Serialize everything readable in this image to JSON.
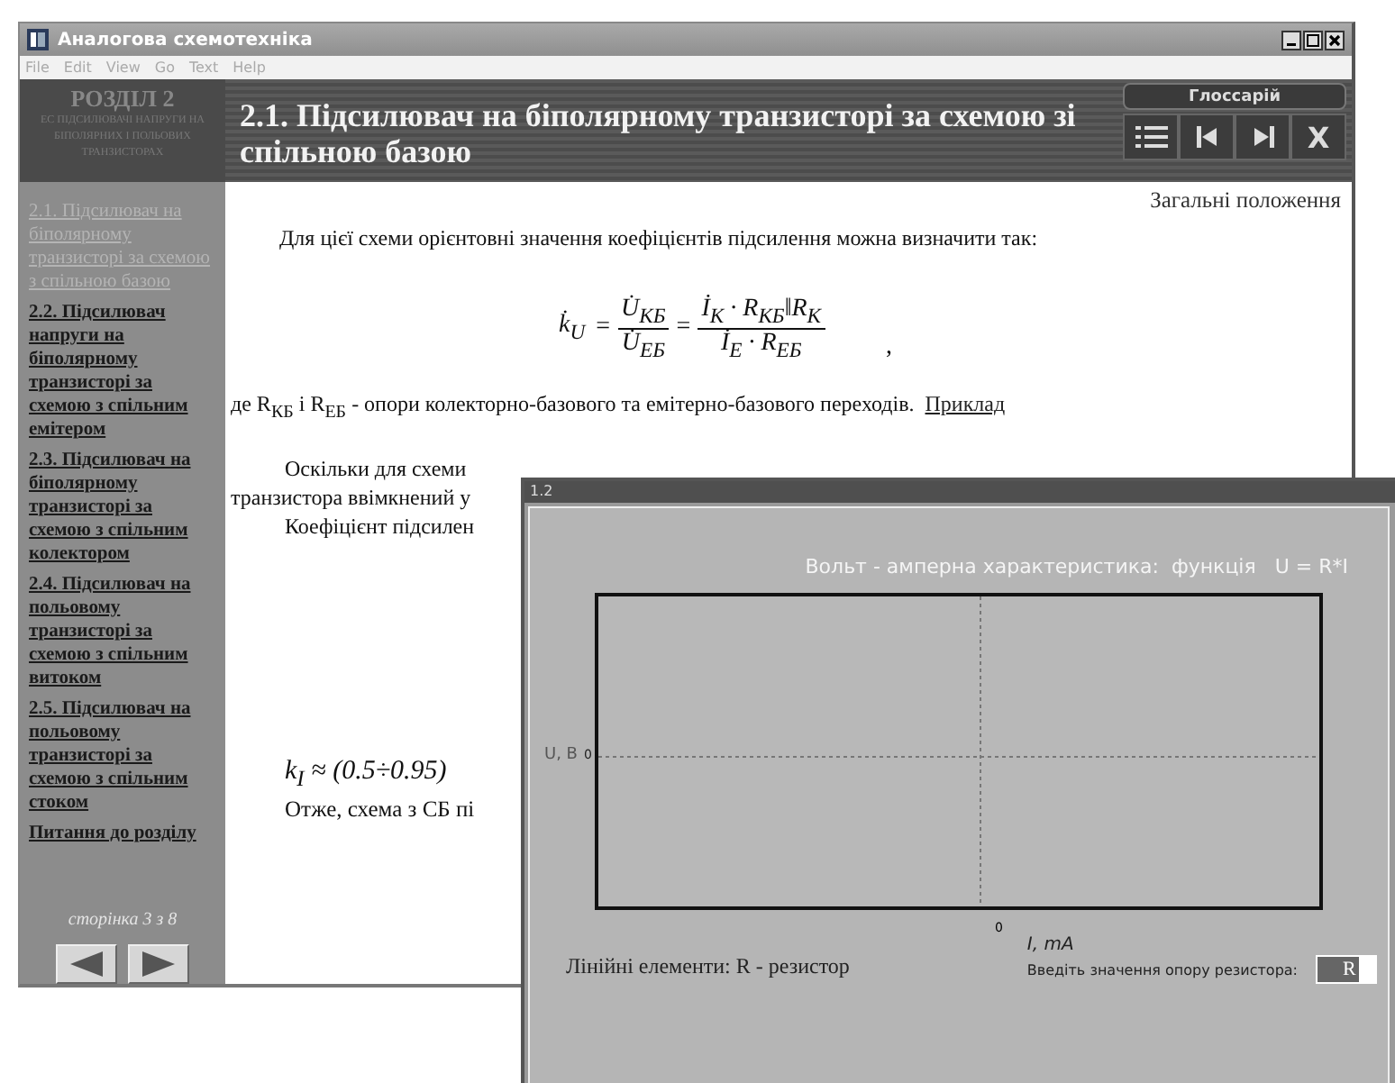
{
  "window": {
    "title": "Аналогова схемотехніка"
  },
  "menu": [
    "File",
    "Edit",
    "View",
    "Go",
    "Text",
    "Help"
  ],
  "sidebar": {
    "section": "РОЗДІЛ 2",
    "subtitle": "ЕС ПІДСИЛЮВАЧІ НАПРУГИ НА БІПОЛЯРНИХ І ПОЛЬОВИХ ТРАНЗИСТОРАХ",
    "items": [
      {
        "label": "2.1. Підсилювач на біполярному транзисторі за схемою з спільною базою",
        "selected": true
      },
      {
        "label": "2.2. Підсилювач напруги на біполярному транзисторі за схемою з спільним емітером",
        "selected": false
      },
      {
        "label": "2.3. Підсилювач на біполярному транзисторі за схемою з спільним колектором",
        "selected": false
      },
      {
        "label": "2.4. Підсилювач на польовому транзисторі за схемою з спільним витоком",
        "selected": false
      },
      {
        "label": "2.5. Підсилювач на польовому транзисторі за схемою з спільним стоком",
        "selected": false
      },
      {
        "label": "Питання до розділу",
        "selected": false
      }
    ],
    "page": "сторінка 3 з 8"
  },
  "header": {
    "title": "2.1. Підсилювач на біполярному транзисторі за схемою зі спільною базою",
    "glossary": "Глоссарій",
    "close": "X"
  },
  "content": {
    "section_label": "Загальні положення",
    "intro": "Для цієї схеми орієнтовні значення коефіцієнтів підсилення можна визначити так:",
    "formula": {
      "lhs": "k̇$_{U}$",
      "num1": "U̇$_{КБ}$",
      "den1": "U̇$_{ЕБ}$",
      "num2": "İ$_{К}$ · R$_{КБ}$‖R$_{К}$",
      "den2": "İ$_{Е}$ · R$_{ЕБ}$",
      "eq": "=",
      "trail": ","
    },
    "definition": "де R$_{КБ}$ і R$_{ЕБ}$ - опори колекторно-базового та емітерно-базового переходів.",
    "example_link": "Приклад",
    "paragraphs": [
      [
        "Оскільки для схеми",
        "транзистора ввімкнений у"
      ],
      [
        "Коефіцієнт підсилен"
      ]
    ],
    "current_gain": "k$_{I}$ ≈ (0.5÷0.95)",
    "conclusion": "Отже, схема з СБ пі"
  },
  "popup": {
    "title": "1.2",
    "heading": "Вольт - амперна характеристика:  функція   U = R*I",
    "y_label": "U, B",
    "y_tick": "0",
    "x_tick": "0",
    "x_label": "I, mA",
    "elements": "Лінійні елементи: R - резистор",
    "prompt": "Введіть значення опору резистора:",
    "value": "R"
  }
}
